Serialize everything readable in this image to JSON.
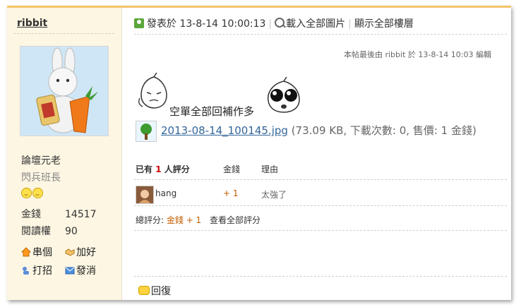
{
  "author": {
    "name": "ribbit"
  },
  "profile": {
    "rank_title": "論壇元老",
    "group": "閃兵班長",
    "stats": [
      {
        "label": "金錢",
        "value": "14517"
      },
      {
        "label": "閱讀權",
        "value": "90"
      }
    ],
    "actions": [
      {
        "label": "串個",
        "icon": "home-icon"
      },
      {
        "label": "加好",
        "icon": "handshake-icon"
      },
      {
        "label": "打招",
        "icon": "poke-icon"
      },
      {
        "label": "發消",
        "icon": "mail-icon"
      }
    ]
  },
  "post": {
    "posted_label": "發表於 13-8-14 10:00:13",
    "load_images_label": "載入全部圖片",
    "show_all_floors_label": "顯示全部樓層",
    "last_edited": "本帖最後由 ribbit 於 13-8-14 10:03 編輯",
    "text": "空單全部回補作多",
    "attachment": {
      "filename": "2013-08-14_100145.jpg",
      "meta": "(73.09 KB, 下載次數: 0, 售價: 1 金錢)"
    }
  },
  "rating": {
    "header_prefix": "已有",
    "count": "1",
    "header_suffix": "人評分",
    "col_money": "金錢",
    "col_reason": "理由",
    "rows": [
      {
        "user": "hang",
        "value": "+ 1",
        "reason": "太強了"
      }
    ],
    "total_label": "總評分:",
    "total_value": "金錢 + 1",
    "view_all_label": "查看全部評分"
  },
  "footer": {
    "reply_label": "回復"
  },
  "colors": {
    "accent_border": "#f4c46b",
    "sidebar_bg": "#fdf6e3",
    "link": "#336699",
    "rating_value": "#c25e00"
  }
}
